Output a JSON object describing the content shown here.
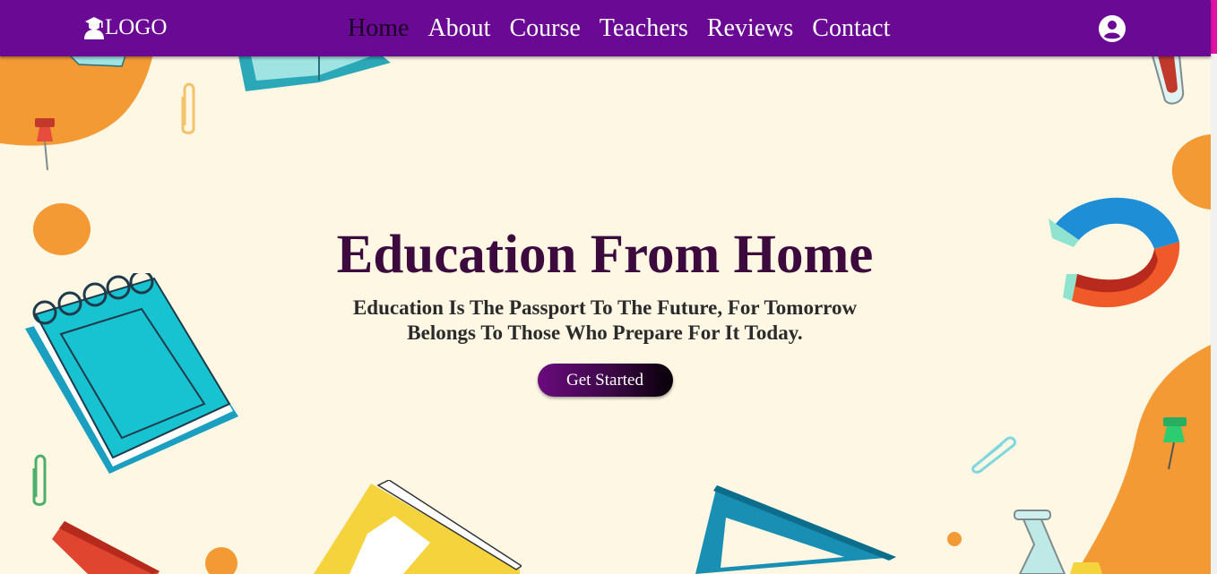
{
  "colors": {
    "navbar_bg": "#6a0a94",
    "hero_bg": "#fdf7e4",
    "title": "#3d0a3e",
    "accent_orange": "#f39a34",
    "scroll_thumb": "#e211a6"
  },
  "nav": {
    "logo_icon": "graduate-icon",
    "logo_text": "LOGO",
    "links": [
      {
        "label": "Home",
        "active": true
      },
      {
        "label": "About",
        "active": false
      },
      {
        "label": "Course",
        "active": false
      },
      {
        "label": "Teachers",
        "active": false
      },
      {
        "label": "Reviews",
        "active": false
      },
      {
        "label": "Contact",
        "active": false
      }
    ],
    "user_icon": "user-circle-icon"
  },
  "hero": {
    "title": "Education From Home",
    "subtitle": "Education Is The Passport To The Future, For Tomorrow Belongs To Those Who Prepare For It Today.",
    "cta_label": "Get Started"
  },
  "decorations": [
    "orange-blob-icon",
    "pushpin-red-icon",
    "paperclip-icon",
    "open-book-icon",
    "test-tube-icon",
    "magnet-icon",
    "notepad-icon",
    "pushpin-green-icon",
    "yellow-book-icon",
    "set-square-icon",
    "ruler-icon",
    "flask-icon"
  ]
}
